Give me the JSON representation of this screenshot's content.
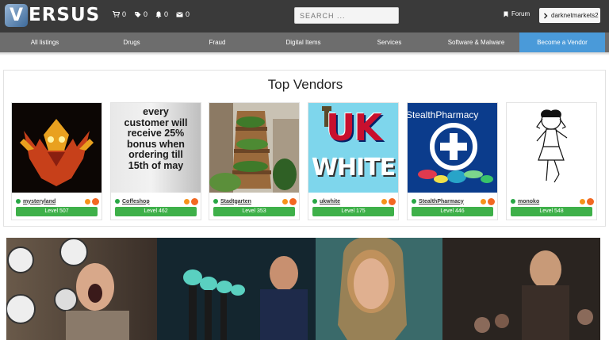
{
  "header": {
    "logo_mark": "V",
    "logo_text": "ERSUS",
    "counters": [
      {
        "icon": "cart-icon",
        "value": "0"
      },
      {
        "icon": "tag-icon",
        "value": "0"
      },
      {
        "icon": "bell-icon",
        "value": "0"
      },
      {
        "icon": "envelope-icon",
        "value": "0"
      }
    ],
    "search_placeholder": "SEARCH ...",
    "forum_label": "Forum",
    "user_label": "darknetmarkets2"
  },
  "nav": {
    "items": [
      {
        "label": "All listings"
      },
      {
        "label": "Drugs"
      },
      {
        "label": "Fraud"
      },
      {
        "label": "Digital Items"
      },
      {
        "label": "Services"
      },
      {
        "label": "Software & Malware"
      },
      {
        "label": "Become a Vendor",
        "active": true
      }
    ]
  },
  "vendors_section": {
    "title": "Top Vendors",
    "vendors": [
      {
        "name": "mysteryland",
        "level": "Level 507"
      },
      {
        "name": "Coffeshop",
        "level": "Level 462",
        "image_text": "every customer will receive 25% bonus when ordering till 15th of may"
      },
      {
        "name": "Stadtgarten",
        "level": "Level 353"
      },
      {
        "name": "ukwhite",
        "level": "Level 175",
        "image_text_top": "UK",
        "image_text_bottom": "WHITE"
      },
      {
        "name": "StealthPharmacy",
        "level": "Level 446",
        "image_text": "StealthPharmacy"
      },
      {
        "name": "monoko",
        "level": "Level 548"
      }
    ]
  },
  "colors": {
    "topbar": "#3a3a3a",
    "nav": "#6d6d6d",
    "nav_active": "#4a9ad9",
    "level_badge": "#3eb049",
    "online_dot": "#28a745"
  }
}
